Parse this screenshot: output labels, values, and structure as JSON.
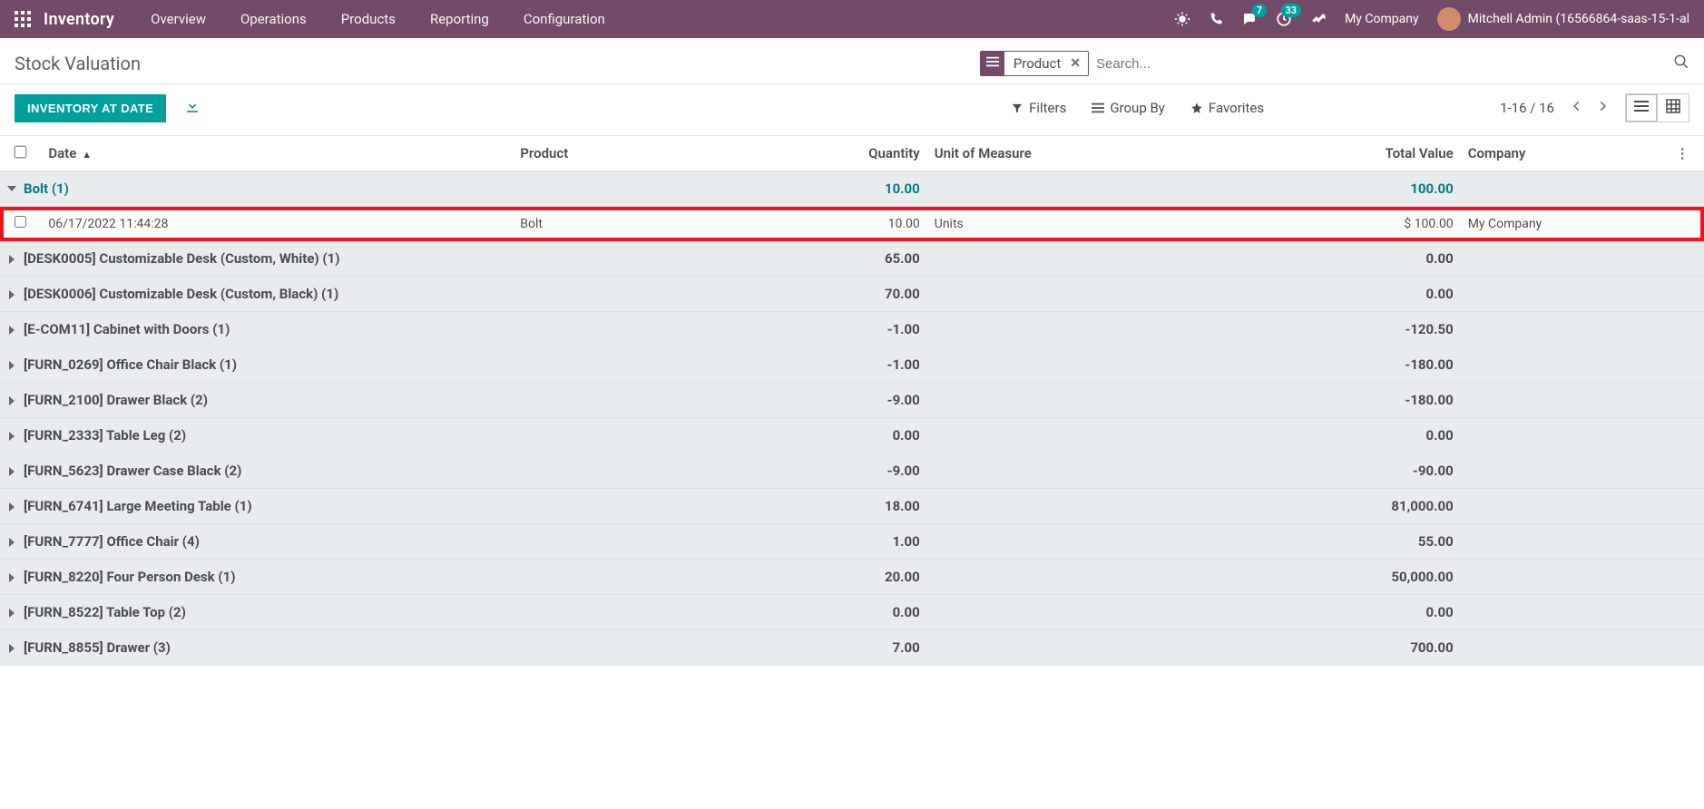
{
  "nav": {
    "brand": "Inventory",
    "menu": [
      "Overview",
      "Operations",
      "Products",
      "Reporting",
      "Configuration"
    ],
    "messaging_badge": "7",
    "activities_badge": "33",
    "company": "My Company",
    "user": "Mitchell Admin (16566864-saas-15-1-al"
  },
  "breadcrumb": {
    "title": "Stock Valuation"
  },
  "search": {
    "facet_label": "Product",
    "placeholder": "Search..."
  },
  "controls": {
    "primary_button": "INVENTORY AT DATE",
    "filters": "Filters",
    "groupby": "Group By",
    "favorites": "Favorites",
    "pager": "1-16 / 16"
  },
  "columns": {
    "date": "Date",
    "product": "Product",
    "quantity": "Quantity",
    "uom": "Unit of Measure",
    "total_value": "Total Value",
    "company": "Company"
  },
  "groups": [
    {
      "name": "Bolt (1)",
      "qty": "10.00",
      "val": "100.00",
      "expanded": true,
      "rows": [
        {
          "date": "06/17/2022 11:44:28",
          "product": "Bolt",
          "qty": "10.00",
          "uom": "Units",
          "val": "$ 100.00",
          "company": "My Company",
          "highlight": true
        }
      ]
    },
    {
      "name": "[DESK0005] Customizable Desk (Custom, White) (1)",
      "qty": "65.00",
      "val": "0.00"
    },
    {
      "name": "[DESK0006] Customizable Desk (Custom, Black) (1)",
      "qty": "70.00",
      "val": "0.00"
    },
    {
      "name": "[E-COM11] Cabinet with Doors (1)",
      "qty": "-1.00",
      "val": "-120.50"
    },
    {
      "name": "[FURN_0269] Office Chair Black (1)",
      "qty": "-1.00",
      "val": "-180.00"
    },
    {
      "name": "[FURN_2100] Drawer Black (2)",
      "qty": "-9.00",
      "val": "-180.00"
    },
    {
      "name": "[FURN_2333] Table Leg (2)",
      "qty": "0.00",
      "val": "0.00"
    },
    {
      "name": "[FURN_5623] Drawer Case Black (2)",
      "qty": "-9.00",
      "val": "-90.00"
    },
    {
      "name": "[FURN_6741] Large Meeting Table (1)",
      "qty": "18.00",
      "val": "81,000.00"
    },
    {
      "name": "[FURN_7777] Office Chair (4)",
      "qty": "1.00",
      "val": "55.00"
    },
    {
      "name": "[FURN_8220] Four Person Desk (1)",
      "qty": "20.00",
      "val": "50,000.00"
    },
    {
      "name": "[FURN_8522] Table Top (2)",
      "qty": "0.00",
      "val": "0.00"
    },
    {
      "name": "[FURN_8855] Drawer (3)",
      "qty": "7.00",
      "val": "700.00"
    }
  ]
}
